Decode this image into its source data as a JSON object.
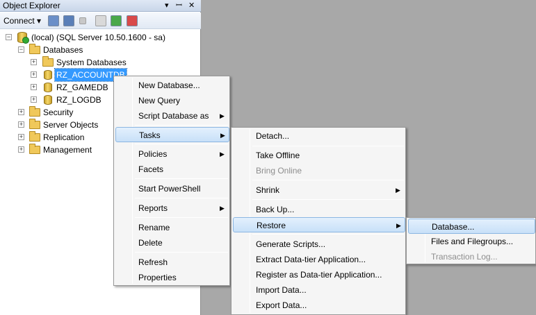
{
  "explorer": {
    "title": "Object Explorer",
    "title_controls": {
      "dropdown": "▾",
      "pin": "ꟷ",
      "close": "✕"
    },
    "toolbar": {
      "connect_label": "Connect",
      "connect_arrow": "▾"
    }
  },
  "tree": {
    "server": "(local) (SQL Server 10.50.1600 - sa)",
    "databases": "Databases",
    "system_databases": "System Databases",
    "db1": "RZ_ACCOUNTDB",
    "db2": "RZ_GAMEDB",
    "db3": "RZ_LOGDB",
    "security": "Security",
    "server_objects": "Server Objects",
    "replication": "Replication",
    "management": "Management",
    "collapse_sign": "−",
    "expand_sign": "+"
  },
  "context_menu": {
    "new_database": "New Database...",
    "new_query": "New Query",
    "script_database_as": "Script Database as",
    "tasks": "Tasks",
    "policies": "Policies",
    "facets": "Facets",
    "start_powershell": "Start PowerShell",
    "reports": "Reports",
    "rename": "Rename",
    "delete": "Delete",
    "refresh": "Refresh",
    "properties": "Properties",
    "submenu_arrow": "▶"
  },
  "tasks_menu": {
    "detach": "Detach...",
    "take_offline": "Take Offline",
    "bring_online": "Bring Online",
    "shrink": "Shrink",
    "back_up": "Back Up...",
    "restore": "Restore",
    "generate_scripts": "Generate Scripts...",
    "extract_dac": "Extract Data-tier Application...",
    "register_dac": "Register as Data-tier Application...",
    "import_data": "Import Data...",
    "export_data": "Export Data..."
  },
  "restore_menu": {
    "database": "Database...",
    "files_filegroups": "Files and Filegroups...",
    "transaction_log": "Transaction Log..."
  },
  "colors": {
    "selection": "#3399ff",
    "menu_highlight": "#c8e0f8",
    "workspace": "#a8a8a8"
  }
}
